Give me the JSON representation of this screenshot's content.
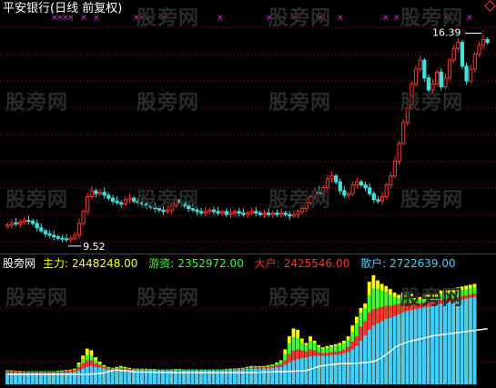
{
  "title": "平安银行(日线 前复权)",
  "watermark": "股旁网",
  "price_high_label": "16.39",
  "price_low_label": "9.52",
  "indicator": {
    "name": "股旁网",
    "items": [
      {
        "label": "主力:",
        "value": "2448248.00",
        "color": "#ffff00"
      },
      {
        "label": "游资:",
        "value": "2352972.00",
        "color": "#33ff33"
      },
      {
        "label": "大户:",
        "value": "2425546.00",
        "color": "#ff3030"
      },
      {
        "label": "散户:",
        "value": "2722639.00",
        "color": "#40d0ff"
      }
    ]
  },
  "chart_data": [
    {
      "type": "candlestick",
      "title": "平安银行(日线 前复权)",
      "marked_high": 16.39,
      "marked_low": 9.52,
      "close": [
        10.05,
        10.12,
        10.08,
        10.15,
        10.2,
        10.18,
        10.1,
        9.95,
        9.85,
        9.75,
        9.7,
        9.65,
        9.6,
        9.58,
        9.55,
        9.6,
        9.7,
        10.1,
        10.5,
        11.0,
        11.2,
        11.1,
        11.15,
        11.05,
        10.95,
        10.85,
        10.8,
        10.75,
        10.9,
        10.95,
        10.85,
        10.8,
        10.75,
        10.7,
        10.65,
        10.6,
        10.55,
        10.5,
        10.55,
        10.7,
        10.9,
        10.8,
        10.7,
        10.6,
        10.55,
        10.5,
        10.45,
        10.5,
        10.55,
        10.5,
        10.45,
        10.5,
        10.4,
        10.45,
        10.5,
        10.45,
        10.4,
        10.45,
        10.5,
        10.45,
        10.4,
        10.45,
        10.4,
        10.45,
        10.4,
        10.45,
        10.4,
        10.35,
        10.4,
        10.5,
        10.6,
        10.8,
        11.0,
        11.2,
        11.1,
        11.3,
        11.6,
        11.7,
        11.5,
        11.2,
        11.05,
        11.1,
        11.4,
        11.5,
        11.4,
        11.3,
        11.1,
        10.9,
        10.85,
        11.0,
        11.4,
        11.7,
        12.2,
        12.8,
        13.5,
        14.0,
        14.8,
        15.3,
        15.6,
        15.0,
        14.6,
        14.8,
        15.2,
        14.7,
        15.0,
        15.6,
        16.0,
        16.2,
        15.4,
        14.9,
        15.3,
        15.8,
        16.1,
        16.3,
        16.2
      ],
      "series": [
        {
          "name": "主力",
          "color": "#ffff00",
          "values": [
            0.32,
            0.32,
            0.31,
            0.31,
            0.3,
            0.3,
            0.3,
            0.3,
            0.3,
            0.3,
            0.3,
            0.3,
            0.31,
            0.32,
            0.33,
            0.34,
            0.36,
            0.5,
            0.66,
            0.82,
            0.78,
            0.62,
            0.52,
            0.44,
            0.4,
            0.38,
            0.4,
            0.42,
            0.4,
            0.38,
            0.36,
            0.36,
            0.36,
            0.36,
            0.35,
            0.35,
            0.34,
            0.34,
            0.34,
            0.34,
            0.35,
            0.35,
            0.34,
            0.34,
            0.34,
            0.34,
            0.34,
            0.34,
            0.34,
            0.34,
            0.34,
            0.34,
            0.35,
            0.36,
            0.36,
            0.37,
            0.38,
            0.4,
            0.42,
            0.42,
            0.42,
            0.42,
            0.44,
            0.46,
            0.5,
            0.55,
            0.8,
            1.1,
            1.28,
            1.25,
            1.05,
            0.95,
            1.1,
            1.0,
            0.9,
            0.85,
            0.88,
            0.9,
            0.92,
            0.95,
            1.0,
            1.1,
            1.35,
            1.55,
            1.75,
            1.85,
            2.35,
            2.5,
            2.38,
            2.3,
            2.25,
            2.18,
            2.1,
            2.05,
            2.1,
            2.12,
            2.08,
            2.0,
            2.0,
            2.05,
            2.1,
            2.05,
            2.1,
            2.15,
            2.18,
            2.2,
            2.2,
            2.22,
            2.24,
            2.26,
            2.28,
            2.3
          ]
        },
        {
          "name": "游资",
          "color": "#33ff33",
          "values": [
            0.31,
            0.31,
            0.3,
            0.3,
            0.3,
            0.3,
            0.3,
            0.3,
            0.3,
            0.3,
            0.3,
            0.3,
            0.3,
            0.31,
            0.32,
            0.33,
            0.34,
            0.46,
            0.58,
            0.68,
            0.66,
            0.55,
            0.48,
            0.42,
            0.39,
            0.37,
            0.38,
            0.4,
            0.38,
            0.37,
            0.35,
            0.35,
            0.35,
            0.35,
            0.34,
            0.34,
            0.34,
            0.34,
            0.34,
            0.34,
            0.34,
            0.34,
            0.34,
            0.34,
            0.34,
            0.34,
            0.34,
            0.34,
            0.34,
            0.34,
            0.34,
            0.34,
            0.34,
            0.35,
            0.35,
            0.36,
            0.37,
            0.39,
            0.4,
            0.41,
            0.41,
            0.41,
            0.43,
            0.45,
            0.48,
            0.52,
            0.7,
            0.95,
            1.08,
            1.06,
            0.95,
            0.9,
            1.0,
            0.94,
            0.86,
            0.82,
            0.84,
            0.86,
            0.88,
            0.9,
            0.94,
            1.02,
            1.2,
            1.4,
            1.65,
            1.75,
            2.05,
            2.2,
            2.2,
            2.15,
            2.12,
            2.05,
            2.0,
            1.98,
            2.0,
            2.02,
            2.0,
            1.95,
            1.95,
            1.98,
            2.02,
            2.0,
            2.02,
            2.06,
            2.1,
            2.12,
            2.12,
            2.14,
            2.16,
            2.18,
            2.2,
            2.22
          ]
        },
        {
          "name": "大户",
          "color": "#ff3030",
          "values": [
            0.3,
            0.3,
            0.3,
            0.3,
            0.29,
            0.29,
            0.29,
            0.29,
            0.29,
            0.29,
            0.29,
            0.29,
            0.29,
            0.3,
            0.31,
            0.32,
            0.33,
            0.4,
            0.48,
            0.55,
            0.55,
            0.48,
            0.44,
            0.4,
            0.37,
            0.36,
            0.36,
            0.37,
            0.36,
            0.35,
            0.34,
            0.34,
            0.34,
            0.34,
            0.33,
            0.33,
            0.33,
            0.33,
            0.33,
            0.33,
            0.33,
            0.33,
            0.33,
            0.33,
            0.33,
            0.33,
            0.33,
            0.33,
            0.33,
            0.33,
            0.33,
            0.33,
            0.33,
            0.34,
            0.34,
            0.35,
            0.36,
            0.37,
            0.38,
            0.39,
            0.39,
            0.39,
            0.4,
            0.42,
            0.44,
            0.46,
            0.55,
            0.7,
            0.78,
            0.8,
            0.78,
            0.76,
            0.8,
            0.78,
            0.74,
            0.72,
            0.72,
            0.74,
            0.75,
            0.76,
            0.8,
            0.86,
            0.98,
            1.1,
            1.32,
            1.45,
            1.65,
            1.72,
            1.75,
            1.78,
            1.8,
            1.8,
            1.82,
            1.84,
            1.86,
            1.88,
            1.88,
            1.86,
            1.86,
            1.88,
            1.9,
            1.9,
            1.92,
            1.94,
            1.96,
            1.98,
            1.98,
            2.0,
            2.02,
            2.04,
            2.06,
            2.08
          ]
        },
        {
          "name": "散户",
          "color": "#40d0ff",
          "values": [
            0.26,
            0.26,
            0.26,
            0.26,
            0.26,
            0.26,
            0.26,
            0.26,
            0.26,
            0.26,
            0.26,
            0.26,
            0.26,
            0.27,
            0.27,
            0.28,
            0.29,
            0.32,
            0.36,
            0.4,
            0.42,
            0.4,
            0.39,
            0.37,
            0.35,
            0.34,
            0.34,
            0.34,
            0.34,
            0.33,
            0.33,
            0.33,
            0.33,
            0.33,
            0.32,
            0.32,
            0.32,
            0.32,
            0.32,
            0.32,
            0.32,
            0.32,
            0.32,
            0.32,
            0.32,
            0.32,
            0.32,
            0.32,
            0.32,
            0.32,
            0.32,
            0.32,
            0.32,
            0.33,
            0.33,
            0.34,
            0.34,
            0.35,
            0.36,
            0.36,
            0.36,
            0.37,
            0.37,
            0.38,
            0.39,
            0.4,
            0.44,
            0.5,
            0.55,
            0.58,
            0.6,
            0.62,
            0.64,
            0.65,
            0.65,
            0.65,
            0.66,
            0.67,
            0.68,
            0.69,
            0.71,
            0.74,
            0.8,
            0.88,
            1.0,
            1.12,
            1.25,
            1.34,
            1.4,
            1.45,
            1.5,
            1.52,
            1.56,
            1.6,
            1.64,
            1.68,
            1.7,
            1.72,
            1.74,
            1.76,
            1.78,
            1.8,
            1.82,
            1.84,
            1.86,
            1.88,
            1.9,
            1.92,
            1.94,
            1.96,
            1.98,
            2.0
          ]
        }
      ]
    }
  ]
}
